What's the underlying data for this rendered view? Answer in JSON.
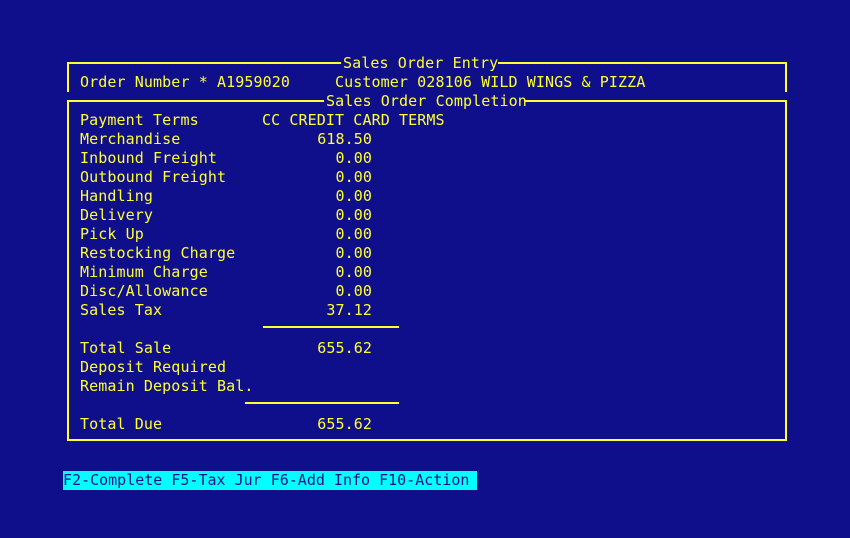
{
  "header": {
    "title": "Sales Order Entry",
    "order_number_label": "Order Number * A1959020",
    "customer_label": "Customer 028106 WILD WINGS & PIZZA"
  },
  "completion": {
    "title": "Sales Order Completion",
    "payment_terms_label": "Payment Terms",
    "payment_terms_value": "CC CREDIT CARD TERMS",
    "lines": [
      {
        "label": "Merchandise",
        "value": "618.50"
      },
      {
        "label": "Inbound Freight",
        "value": "0.00"
      },
      {
        "label": "Outbound Freight",
        "value": "0.00"
      },
      {
        "label": "Handling",
        "value": "0.00"
      },
      {
        "label": "Delivery",
        "value": "0.00"
      },
      {
        "label": "Pick Up",
        "value": "0.00"
      },
      {
        "label": "Restocking Charge",
        "value": "0.00"
      },
      {
        "label": "Minimum Charge",
        "value": "0.00"
      },
      {
        "label": "Disc/Allowance",
        "value": "0.00"
      },
      {
        "label": "Sales Tax",
        "value": "37.12"
      }
    ],
    "total_sale_label": "Total Sale",
    "total_sale_value": "655.62",
    "deposit_required_label": "Deposit Required",
    "remain_deposit_label": "Remain Deposit Bal.",
    "total_due_label": "Total Due",
    "total_due_value": "655.62"
  },
  "function_keys": {
    "label": "F2-Complete F5-Tax Jur F6-Add Info F10-Action"
  },
  "colors": {
    "background": "#0f0f8c",
    "text": "#ffff33",
    "highlight": "#00ffff"
  }
}
